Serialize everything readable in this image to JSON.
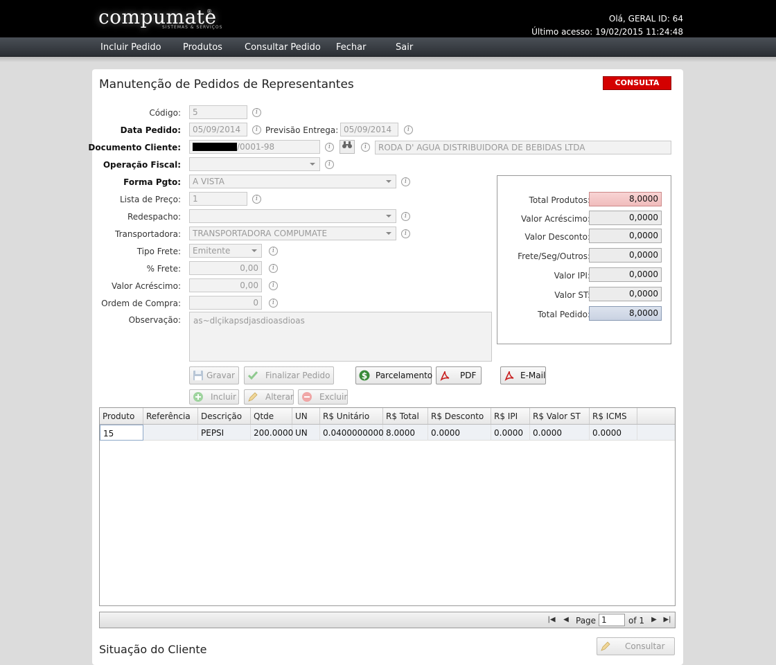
{
  "header": {
    "logo": "compumate",
    "logo_sub": "SISTEMAS & SERVIÇOS",
    "logo_reg": "®",
    "greeting": "Olá, GERAL ID: 64",
    "last_access": "Último acesso: 19/02/2015 11:24:48"
  },
  "menu": [
    "Incluir Pedido",
    "Produtos",
    "Consultar Pedido",
    "Fechar",
    "Sair"
  ],
  "page": {
    "title": "Manutenção de Pedidos de Representantes",
    "mode_badge": "CONSULTA"
  },
  "form": {
    "codigo": {
      "label": "Código:",
      "value": "5"
    },
    "data_pedido": {
      "label": "Data Pedido:",
      "value": "05/09/2014"
    },
    "previsao_entrega": {
      "label": "Previsão Entrega:",
      "value": "05/09/2014"
    },
    "documento_cliente": {
      "label": "Documento Cliente:",
      "value_suffix": "/0001-98",
      "client_name": "RODA D' AGUA DISTRIBUIDORA DE BEBIDAS LTDA"
    },
    "operacao_fiscal": {
      "label": "Operação Fiscal:",
      "value": ""
    },
    "forma_pgto": {
      "label": "Forma Pgto:",
      "value": "A VISTA"
    },
    "lista_preco": {
      "label": "Lista de Preço:",
      "value": "1"
    },
    "redespacho": {
      "label": "Redespacho:",
      "value": ""
    },
    "transportadora": {
      "label": "Transportadora:",
      "value": "TRANSPORTADORA COMPUMATE"
    },
    "tipo_frete": {
      "label": "Tipo Frete:",
      "value": "Emitente"
    },
    "pct_frete": {
      "label": "% Frete:",
      "value": "0,00"
    },
    "valor_acrescimo": {
      "label": "Valor Acréscimo:",
      "value": "0,00"
    },
    "ordem_compra": {
      "label": "Ordem de Compra:",
      "value": "0"
    },
    "observacao": {
      "label": "Observação:",
      "value": "as~dlçikapsdjasdioasdioas"
    },
    "info_glyph": "i"
  },
  "totals": [
    {
      "label": "Total Produtos:",
      "value": "8,0000"
    },
    {
      "label": "Valor Acréscimo:",
      "value": "0,0000"
    },
    {
      "label": "Valor Desconto:",
      "value": "0,0000"
    },
    {
      "label": "Frete/Seg/Outros:",
      "value": "0,0000"
    },
    {
      "label": "Valor IPI:",
      "value": "0,0000"
    },
    {
      "label": "Valor ST:",
      "value": "0,0000"
    },
    {
      "label": "Total Pedido:",
      "value": "8,0000"
    }
  ],
  "buttons": {
    "gravar": "Gravar",
    "finalizar": "Finalizar Pedido",
    "parcelamento": "Parcelamento",
    "pdf": "PDF",
    "email": "E-Mail",
    "incluir": "Incluir",
    "alterar": "Alterar",
    "excluir": "Excluir",
    "consultar": "Consultar"
  },
  "icons": {
    "gravar": "save-icon",
    "finalizar": "check-icon",
    "parcelamento": "dollar-icon",
    "pdf": "pdf-icon",
    "email": "pdf-icon",
    "incluir": "plus-icon",
    "alterar": "pencil-icon",
    "excluir": "minus-icon",
    "consultar": "pencil-icon",
    "search": "binoculars-icon"
  },
  "grid": {
    "columns": [
      "Produto",
      "Referência",
      "Descrição",
      "Qtde",
      "UN",
      "R$ Unitário",
      "R$ Total",
      "R$ Desconto",
      "R$ IPI",
      "R$ Valor ST",
      "R$ ICMS"
    ],
    "rows": [
      [
        "15",
        "",
        "PEPSI",
        "200.0000",
        "UN",
        "0.0400000000",
        "8.0000",
        "0.0000",
        "0.0000",
        "0.0000",
        "0.0000"
      ]
    ]
  },
  "pager": {
    "page_label": "Page",
    "page_value": "1",
    "of_label": "of 1"
  },
  "section": {
    "situacao": "Situação do Cliente"
  },
  "colors": {
    "badge": "#d40000",
    "header_bg": "#000000",
    "menu_bg": "#3a3f45"
  }
}
